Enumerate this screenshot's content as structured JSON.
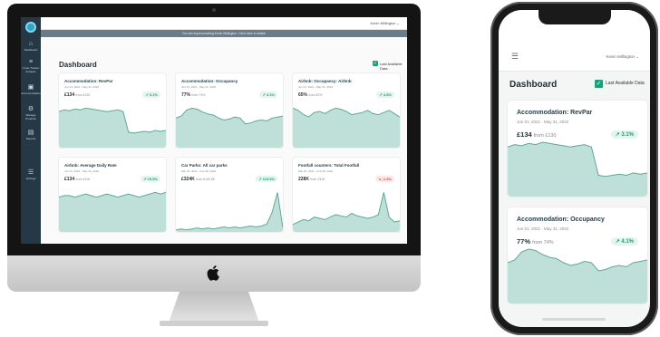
{
  "app": {
    "user_menu": "Kevin Millington ⌄",
    "impersonation_banner": "You are impersonating Kevin Millington. Click here to switch",
    "dashboard_title": "Dashboard",
    "last_available_label": "Last Available Data"
  },
  "colors": {
    "sidebar": "#243845",
    "accent_green": "#1f9e7a",
    "accent_red": "#d64545",
    "chart_fill": "#bfe0d8",
    "chart_line": "#5fa898"
  },
  "nav": [
    {
      "icon": "home-icon",
      "glyph": "⌂",
      "label": "Dashboard"
    },
    {
      "icon": "chart-icon",
      "glyph": "≡",
      "label": "Cross Tracker Analysis"
    },
    {
      "icon": "bed-icon",
      "glyph": "▣",
      "label": "Accommodation"
    },
    {
      "icon": "settings-icon",
      "glyph": "⚙",
      "label": "Manage Products"
    },
    {
      "icon": "report-icon",
      "glyph": "▤",
      "label": "Reports"
    },
    {
      "icon": "settings-icon",
      "glyph": "☰",
      "label": "Settings"
    }
  ],
  "cards": [
    {
      "title": "Accommodation: RevPar",
      "dates": "Jun 01, 2021 - May 31, 2022",
      "value": "£134",
      "from": "from £130",
      "change": "↗ 3.1%",
      "direction": "up",
      "series": [
        42,
        44,
        43,
        45,
        44,
        46,
        45,
        44,
        43,
        42,
        43,
        44,
        42,
        18,
        17,
        18,
        19,
        18,
        20,
        19,
        20
      ]
    },
    {
      "title": "Accommodation: Occupancy",
      "dates": "Jun 01, 2021 - May 31, 2022",
      "value": "77%",
      "from": "from 74%",
      "change": "↗ 4.1%",
      "direction": "up",
      "series": [
        30,
        32,
        38,
        40,
        39,
        36,
        34,
        33,
        30,
        28,
        29,
        31,
        30,
        24,
        25,
        27,
        28,
        27,
        30,
        31,
        32
      ]
    },
    {
      "title": "Airbnb: Occupancy: Airbnb",
      "dates": "Jun 01, 2021 - May 31, 2022",
      "value": "65%",
      "from": "from 62%",
      "change": "↗ 4.8%",
      "direction": "up",
      "series": [
        36,
        34,
        30,
        28,
        32,
        33,
        31,
        34,
        36,
        35,
        33,
        30,
        31,
        32,
        34,
        31,
        30,
        32,
        34,
        31,
        28
      ]
    },
    {
      "title": "Airbnb: Average Daily Rate",
      "dates": "Jun 01, 2021 - May 31, 2022",
      "value": "£134",
      "from": "from £116",
      "change": "↗ 15.5%",
      "direction": "up",
      "series": [
        22,
        23,
        23,
        22,
        23,
        24,
        23,
        22,
        23,
        24,
        23,
        22,
        23,
        24,
        23,
        22,
        23,
        24,
        25,
        24,
        25
      ]
    },
    {
      "title": "Car Parks: All car parks",
      "dates": "Mar 20, 2021 - Feb 28, 2022",
      "value": "£324K",
      "from": "from £160.5K",
      "change": "↗ 119.5%",
      "direction": "up",
      "series": [
        2,
        3,
        2,
        3,
        4,
        3,
        4,
        3,
        4,
        5,
        4,
        5,
        4,
        5,
        6,
        5,
        6,
        8,
        20,
        40,
        4
      ]
    },
    {
      "title": "Footfall counters: Total Footfall",
      "dates": "Mar 20, 2021 - Feb 28, 2022",
      "value": "228K",
      "from": "from 231K",
      "change": "↘ -1.3%",
      "direction": "down",
      "series": [
        6,
        8,
        10,
        9,
        12,
        11,
        10,
        12,
        14,
        13,
        12,
        15,
        13,
        12,
        11,
        12,
        14,
        32,
        12,
        8,
        9
      ]
    }
  ],
  "phone": {
    "user_menu": "Kevin Millington ⌄",
    "dashboard_title": "Dashboard",
    "last_available_label": "Last Available Data",
    "cards": [
      {
        "title": "Accommodation: RevPar",
        "dates": "Jun 01, 2021 - May 31, 2022",
        "value": "£134",
        "from": "from £130",
        "change": "↗ 3.1%",
        "direction": "up",
        "series": [
          42,
          44,
          43,
          45,
          44,
          46,
          45,
          44,
          43,
          42,
          43,
          44,
          42,
          18,
          17,
          18,
          19,
          18,
          20,
          19,
          20
        ]
      },
      {
        "title": "Accommodation: Occupancy",
        "dates": "Jun 01, 2021 - May 31, 2022",
        "value": "77%",
        "from": "from 74%",
        "change": "↗ 4.1%",
        "direction": "up",
        "series": [
          30,
          32,
          38,
          40,
          39,
          36,
          34,
          33,
          30,
          28,
          29,
          31,
          30,
          24,
          25,
          27,
          28,
          27,
          30,
          31,
          32
        ]
      }
    ]
  }
}
